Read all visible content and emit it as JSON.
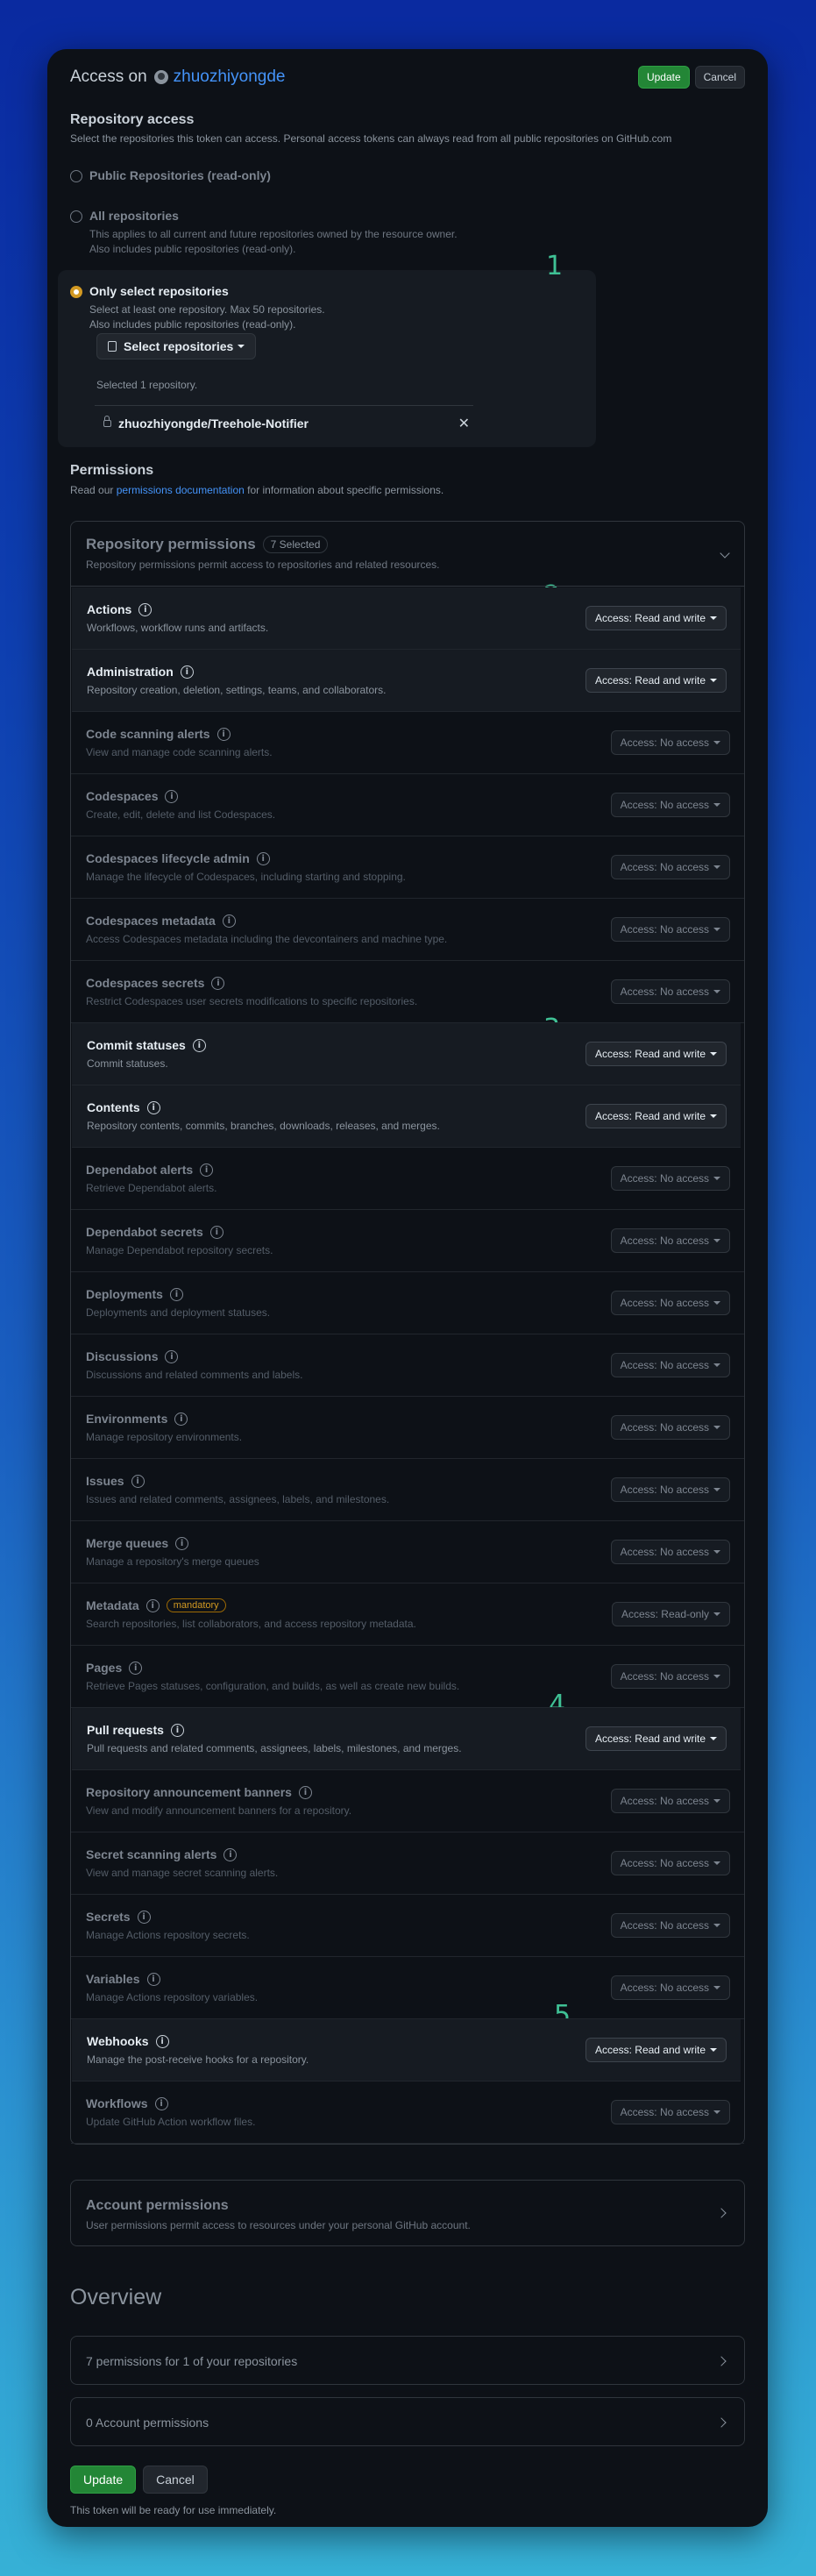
{
  "header": {
    "title": "Access on",
    "owner": "zhuozhiyongde",
    "update_label": "Update",
    "cancel_label": "Cancel"
  },
  "repository_access": {
    "heading": "Repository access",
    "description": "Select the repositories this token can access. Personal access tokens can always read from all public repositories on GitHub.com",
    "options": [
      {
        "label": "Public Repositories (read-only)",
        "desc1": "",
        "desc2": "",
        "selected": false
      },
      {
        "label": "All repositories",
        "desc1": "This applies to all current and future repositories owned by the resource owner.",
        "desc2": "Also includes public repositories (read-only).",
        "selected": false
      },
      {
        "label": "Only select repositories",
        "desc1": "Select at least one repository. Max 50 repositories.",
        "desc2": "Also includes public repositories (read-only).",
        "selected": true
      }
    ],
    "select_button": "Select repositories",
    "selected_count": "Selected 1 repository.",
    "selected_repo": "zhuozhiyongde/Treehole-Notifier"
  },
  "markers": [
    "1",
    "2",
    "3",
    "4",
    "5"
  ],
  "permissions": {
    "heading": "Permissions",
    "desc_prefix": "Read our",
    "desc_link": "permissions documentation",
    "desc_suffix": "for information about specific permissions.",
    "repo_perm_title": "Repository permissions",
    "repo_perm_count": "7 Selected",
    "repo_perm_desc": "Repository permissions permit access to repositories and related resources.",
    "rows": [
      {
        "name": "Actions",
        "desc": "Workflows, workflow runs and artifacts.",
        "access": "Access: Read and write",
        "active": true,
        "badge": ""
      },
      {
        "name": "Administration",
        "desc": "Repository creation, deletion, settings, teams, and collaborators.",
        "access": "Access: Read and write",
        "active": true,
        "badge": ""
      },
      {
        "name": "Code scanning alerts",
        "desc": "View and manage code scanning alerts.",
        "access": "Access: No access",
        "active": false,
        "badge": ""
      },
      {
        "name": "Codespaces",
        "desc": "Create, edit, delete and list Codespaces.",
        "access": "Access: No access",
        "active": false,
        "badge": ""
      },
      {
        "name": "Codespaces lifecycle admin",
        "desc": "Manage the lifecycle of Codespaces, including starting and stopping.",
        "access": "Access: No access",
        "active": false,
        "badge": ""
      },
      {
        "name": "Codespaces metadata",
        "desc": "Access Codespaces metadata including the devcontainers and machine type.",
        "access": "Access: No access",
        "active": false,
        "badge": ""
      },
      {
        "name": "Codespaces secrets",
        "desc": "Restrict Codespaces user secrets modifications to specific repositories.",
        "access": "Access: No access",
        "active": false,
        "badge": ""
      },
      {
        "name": "Commit statuses",
        "desc": "Commit statuses.",
        "access": "Access: Read and write",
        "active": true,
        "badge": ""
      },
      {
        "name": "Contents",
        "desc": "Repository contents, commits, branches, downloads, releases, and merges.",
        "access": "Access: Read and write",
        "active": true,
        "badge": ""
      },
      {
        "name": "Dependabot alerts",
        "desc": "Retrieve Dependabot alerts.",
        "access": "Access: No access",
        "active": false,
        "badge": ""
      },
      {
        "name": "Dependabot secrets",
        "desc": "Manage Dependabot repository secrets.",
        "access": "Access: No access",
        "active": false,
        "badge": ""
      },
      {
        "name": "Deployments",
        "desc": "Deployments and deployment statuses.",
        "access": "Access: No access",
        "active": false,
        "badge": ""
      },
      {
        "name": "Discussions",
        "desc": "Discussions and related comments and labels.",
        "access": "Access: No access",
        "active": false,
        "badge": ""
      },
      {
        "name": "Environments",
        "desc": "Manage repository environments.",
        "access": "Access: No access",
        "active": false,
        "badge": ""
      },
      {
        "name": "Issues",
        "desc": "Issues and related comments, assignees, labels, and milestones.",
        "access": "Access: No access",
        "active": false,
        "badge": ""
      },
      {
        "name": "Merge queues",
        "desc": "Manage a repository's merge queues",
        "access": "Access: No access",
        "active": false,
        "badge": ""
      },
      {
        "name": "Metadata",
        "desc": "Search repositories, list collaborators, and access repository metadata.",
        "access": "Access: Read-only",
        "active": false,
        "badge": "mandatory"
      },
      {
        "name": "Pages",
        "desc": "Retrieve Pages statuses, configuration, and builds, as well as create new builds.",
        "access": "Access: No access",
        "active": false,
        "badge": ""
      },
      {
        "name": "Pull requests",
        "desc": "Pull requests and related comments, assignees, labels, milestones, and merges.",
        "access": "Access: Read and write",
        "active": true,
        "badge": ""
      },
      {
        "name": "Repository announcement banners",
        "desc": "View and modify announcement banners for a repository.",
        "access": "Access: No access",
        "active": false,
        "badge": ""
      },
      {
        "name": "Secret scanning alerts",
        "desc": "View and manage secret scanning alerts.",
        "access": "Access: No access",
        "active": false,
        "badge": ""
      },
      {
        "name": "Secrets",
        "desc": "Manage Actions repository secrets.",
        "access": "Access: No access",
        "active": false,
        "badge": ""
      },
      {
        "name": "Variables",
        "desc": "Manage Actions repository variables.",
        "access": "Access: No access",
        "active": false,
        "badge": ""
      },
      {
        "name": "Webhooks",
        "desc": "Manage the post-receive hooks for a repository.",
        "access": "Access: Read and write",
        "active": true,
        "badge": ""
      },
      {
        "name": "Workflows",
        "desc": "Update GitHub Action workflow files.",
        "access": "Access: No access",
        "active": false,
        "badge": ""
      }
    ],
    "account_title": "Account permissions",
    "account_desc": "User permissions permit access to resources under your personal GitHub account."
  },
  "overview": {
    "heading": "Overview",
    "repo_summary": "7 permissions for 1 of your repositories",
    "account_summary": "0 Account permissions"
  },
  "footer": {
    "update_label": "Update",
    "cancel_label": "Cancel",
    "note": "This token will be ready for use immediately."
  },
  "colors": {
    "accent_green": "#238636",
    "link_blue": "#4493f8",
    "marker_green": "#3fc195",
    "selected_radio": "#d29922"
  }
}
